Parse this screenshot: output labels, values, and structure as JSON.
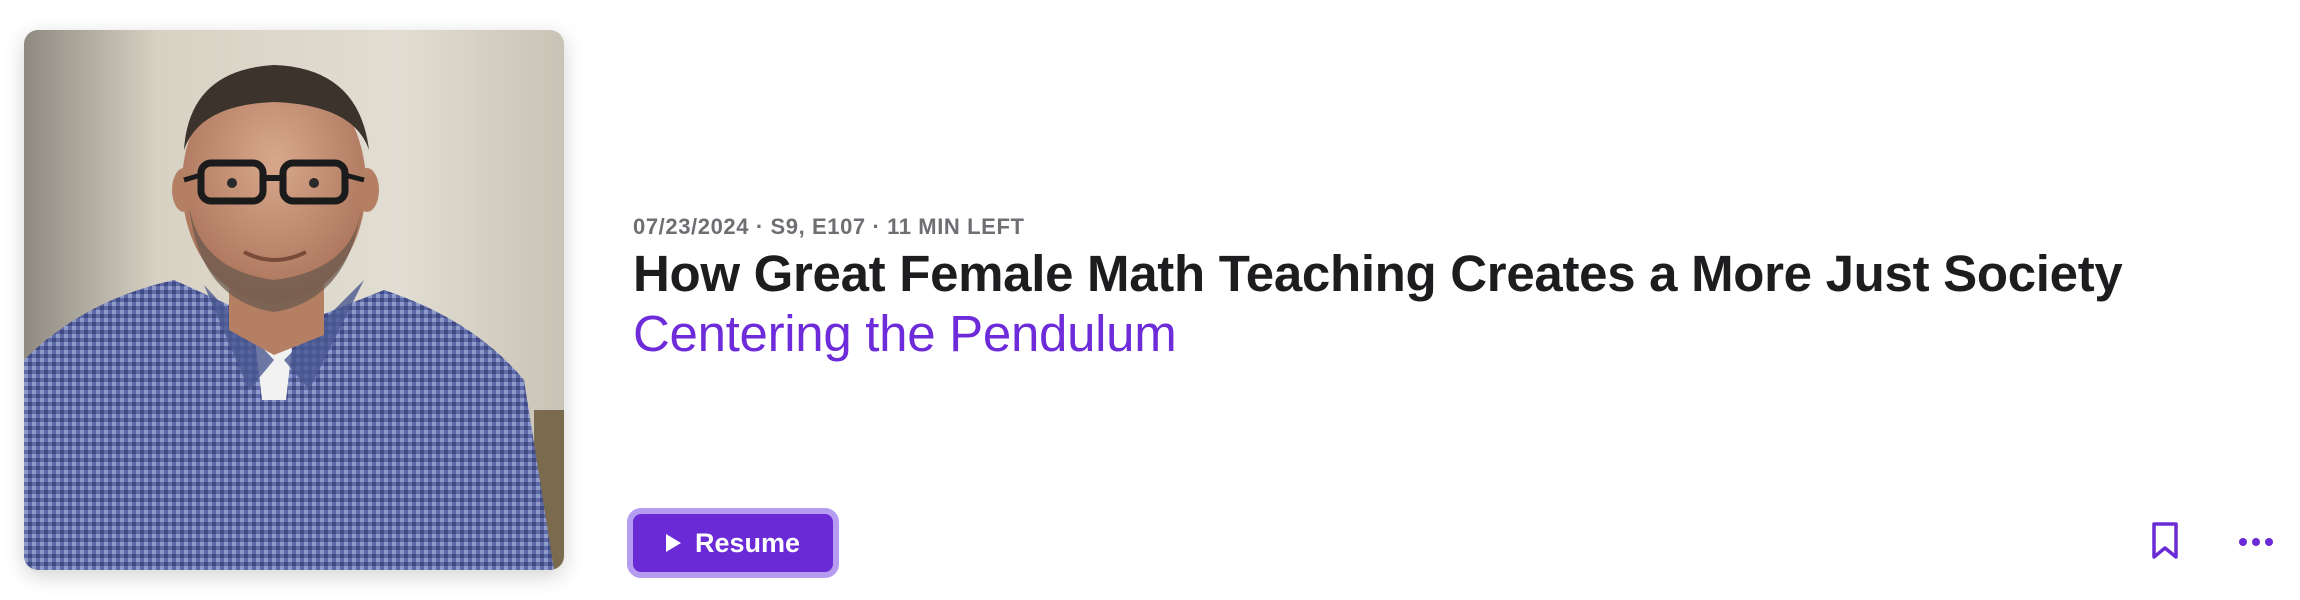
{
  "episode": {
    "meta": "07/23/2024 · S9, E107 · 11 MIN LEFT",
    "title": "How Great Female Math Teaching Creates a More Just Society",
    "show_name": "Centering the Pendulum"
  },
  "actions": {
    "resume_label": "Resume",
    "play_icon": "play-icon",
    "bookmark_icon": "bookmark-icon",
    "more_icon": "ellipsis-icon"
  },
  "colors": {
    "accent": "#6a2bd6",
    "accent_focus_ring": "#b69cf0",
    "meta_text": "#6e6e73",
    "title_text": "#1d1d1f"
  }
}
